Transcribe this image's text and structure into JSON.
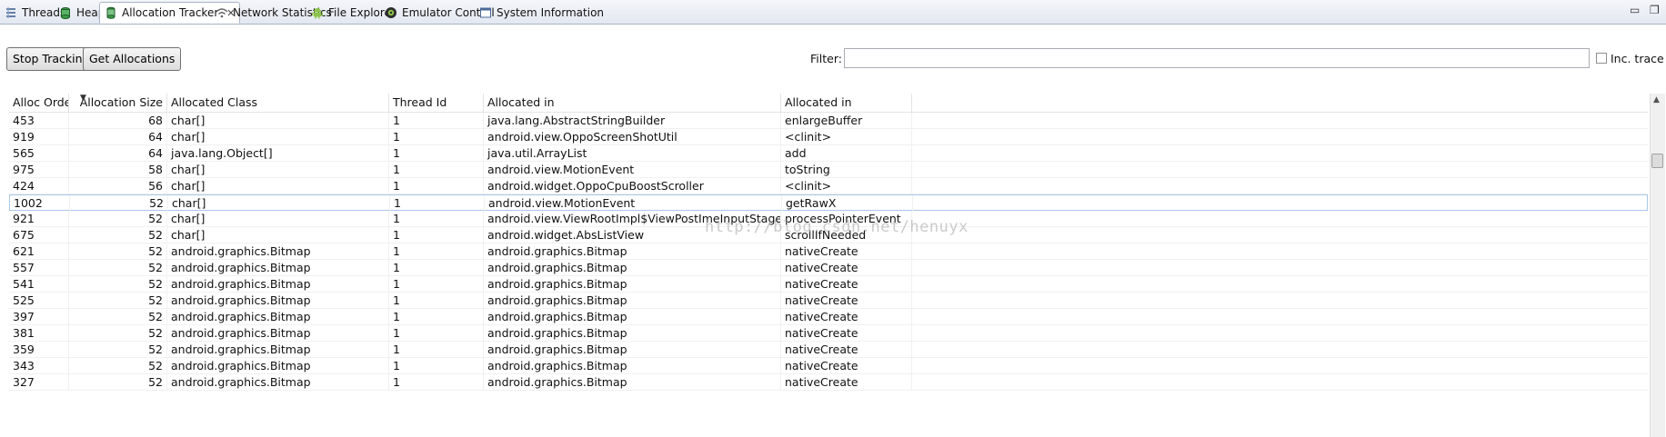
{
  "tabs": [
    {
      "label": "Threads",
      "icon": "threads-icon"
    },
    {
      "label": "Heap",
      "icon": "heap-icon"
    },
    {
      "label": "Allocation Tracker",
      "icon": "allocation-tracker-icon",
      "active": true
    },
    {
      "label": "Network Statistics",
      "icon": "wifi-icon"
    },
    {
      "label": "File Explorer",
      "icon": "android-icon"
    },
    {
      "label": "Emulator Control",
      "icon": "emulator-icon"
    },
    {
      "label": "System Information",
      "icon": "window-icon"
    }
  ],
  "toolbar": {
    "stop_tracking_label": "Stop Tracking",
    "get_allocations_label": "Get Allocations",
    "filter_label": "Filter:",
    "filter_value": "",
    "inc_trace_label": "Inc. trace"
  },
  "table": {
    "columns": [
      "Alloc Order",
      "Allocation Size",
      "Allocated Class",
      "Thread Id",
      "Allocated in",
      "Allocated in"
    ],
    "rows": [
      [
        "453",
        "68",
        "char[]",
        "1",
        "java.lang.AbstractStringBuilder",
        "enlargeBuffer"
      ],
      [
        "919",
        "64",
        "char[]",
        "1",
        "android.view.OppoScreenShotUtil",
        "<clinit>"
      ],
      [
        "565",
        "64",
        "java.lang.Object[]",
        "1",
        "java.util.ArrayList",
        "add"
      ],
      [
        "975",
        "58",
        "char[]",
        "1",
        "android.view.MotionEvent",
        "toString"
      ],
      [
        "424",
        "56",
        "char[]",
        "1",
        "android.widget.OppoCpuBoostScroller",
        "<clinit>"
      ],
      [
        "1002",
        "52",
        "char[]",
        "1",
        "android.view.MotionEvent",
        "getRawX"
      ],
      [
        "921",
        "52",
        "char[]",
        "1",
        "android.view.ViewRootImpl$ViewPostImeInputStage",
        "processPointerEvent"
      ],
      [
        "675",
        "52",
        "char[]",
        "1",
        "android.widget.AbsListView",
        "scrollIfNeeded"
      ],
      [
        "621",
        "52",
        "android.graphics.Bitmap",
        "1",
        "android.graphics.Bitmap",
        "nativeCreate"
      ],
      [
        "557",
        "52",
        "android.graphics.Bitmap",
        "1",
        "android.graphics.Bitmap",
        "nativeCreate"
      ],
      [
        "541",
        "52",
        "android.graphics.Bitmap",
        "1",
        "android.graphics.Bitmap",
        "nativeCreate"
      ],
      [
        "525",
        "52",
        "android.graphics.Bitmap",
        "1",
        "android.graphics.Bitmap",
        "nativeCreate"
      ],
      [
        "397",
        "52",
        "android.graphics.Bitmap",
        "1",
        "android.graphics.Bitmap",
        "nativeCreate"
      ],
      [
        "381",
        "52",
        "android.graphics.Bitmap",
        "1",
        "android.graphics.Bitmap",
        "nativeCreate"
      ],
      [
        "359",
        "52",
        "android.graphics.Bitmap",
        "1",
        "android.graphics.Bitmap",
        "nativeCreate"
      ],
      [
        "343",
        "52",
        "android.graphics.Bitmap",
        "1",
        "android.graphics.Bitmap",
        "nativeCreate"
      ],
      [
        "327",
        "52",
        "android.graphics.Bitmap",
        "1",
        "android.graphics.Bitmap",
        "nativeCreate"
      ]
    ],
    "selected_row": 5
  },
  "watermark": "http://blog.csdn.net/henuyx"
}
